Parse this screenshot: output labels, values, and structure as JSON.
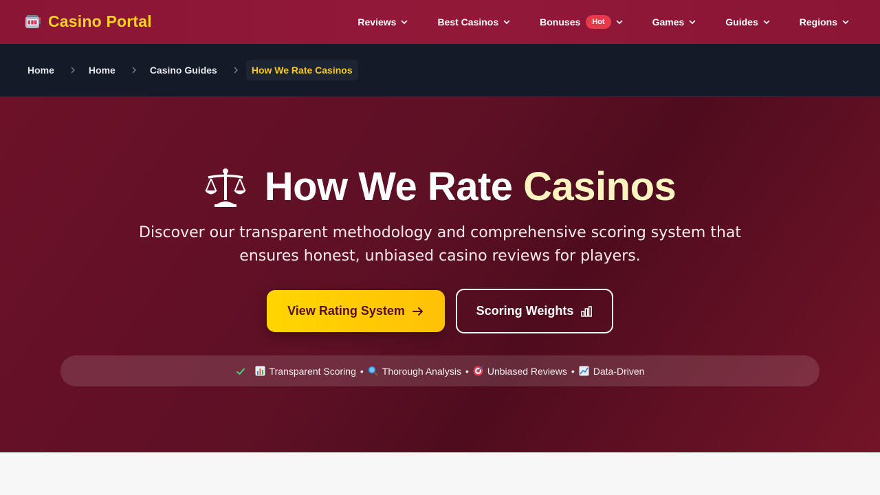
{
  "brand": {
    "name": "Casino Portal",
    "icon": "slot-machine-icon"
  },
  "nav": {
    "items": [
      {
        "label": "Reviews"
      },
      {
        "label": "Best Casinos"
      },
      {
        "label": "Bonuses",
        "badge": "Hot"
      },
      {
        "label": "Games"
      },
      {
        "label": "Guides"
      },
      {
        "label": "Regions"
      }
    ]
  },
  "breadcrumb": {
    "items": [
      "Home",
      "Home",
      "Casino Guides"
    ],
    "current": "How We Rate Casinos"
  },
  "hero": {
    "icon": "balance-scale-icon",
    "title_main": "How We Rate ",
    "title_accent": "Casinos",
    "subtitle": "Discover our transparent methodology and comprehensive scoring system that ensures honest, unbiased casino reviews for players.",
    "primary_button": "View Rating System",
    "secondary_button": "Scoring Weights",
    "features": [
      "Transparent Scoring",
      "Thorough Analysis",
      "Unbiased Reviews",
      "Data-Driven"
    ],
    "feature_separator": "•"
  },
  "colors": {
    "nav_bg": "#8a1535",
    "brand_accent": "#ffd21f",
    "hot_badge": "#e8394a",
    "breadcrumb_bg": "#141a28",
    "breadcrumb_current": "#ffc61a",
    "hero_bg": "#5d1025",
    "primary_button": "#ffd500"
  }
}
